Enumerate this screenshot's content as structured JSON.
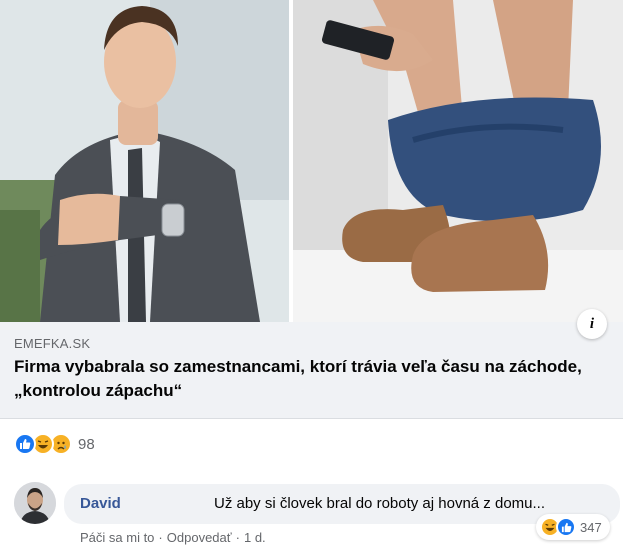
{
  "link_preview": {
    "domain": "EMEFKA.SK",
    "headline": "Firma vybabrala so zamestnancami, ktorí trávia veľa času na záchode, „kontrolou zápachu“",
    "info_icon": "info-icon"
  },
  "post_reactions": {
    "types": [
      "like",
      "haha",
      "sad"
    ],
    "count": "98"
  },
  "comment": {
    "author": "David",
    "text": "Už aby si človek bral do roboty aj hovná z domu...",
    "actions": {
      "like": "Páči sa mi to",
      "reply": "Odpovedať",
      "time": "1 d."
    },
    "reactions": {
      "types": [
        "haha",
        "like"
      ],
      "count": "347"
    }
  },
  "colors": {
    "like_blue": "#1877f2",
    "emoji_yellow": "#f7b125",
    "author_blue": "#385898",
    "muted_gray": "#65676b",
    "panel_bg": "#f0f2f5"
  }
}
